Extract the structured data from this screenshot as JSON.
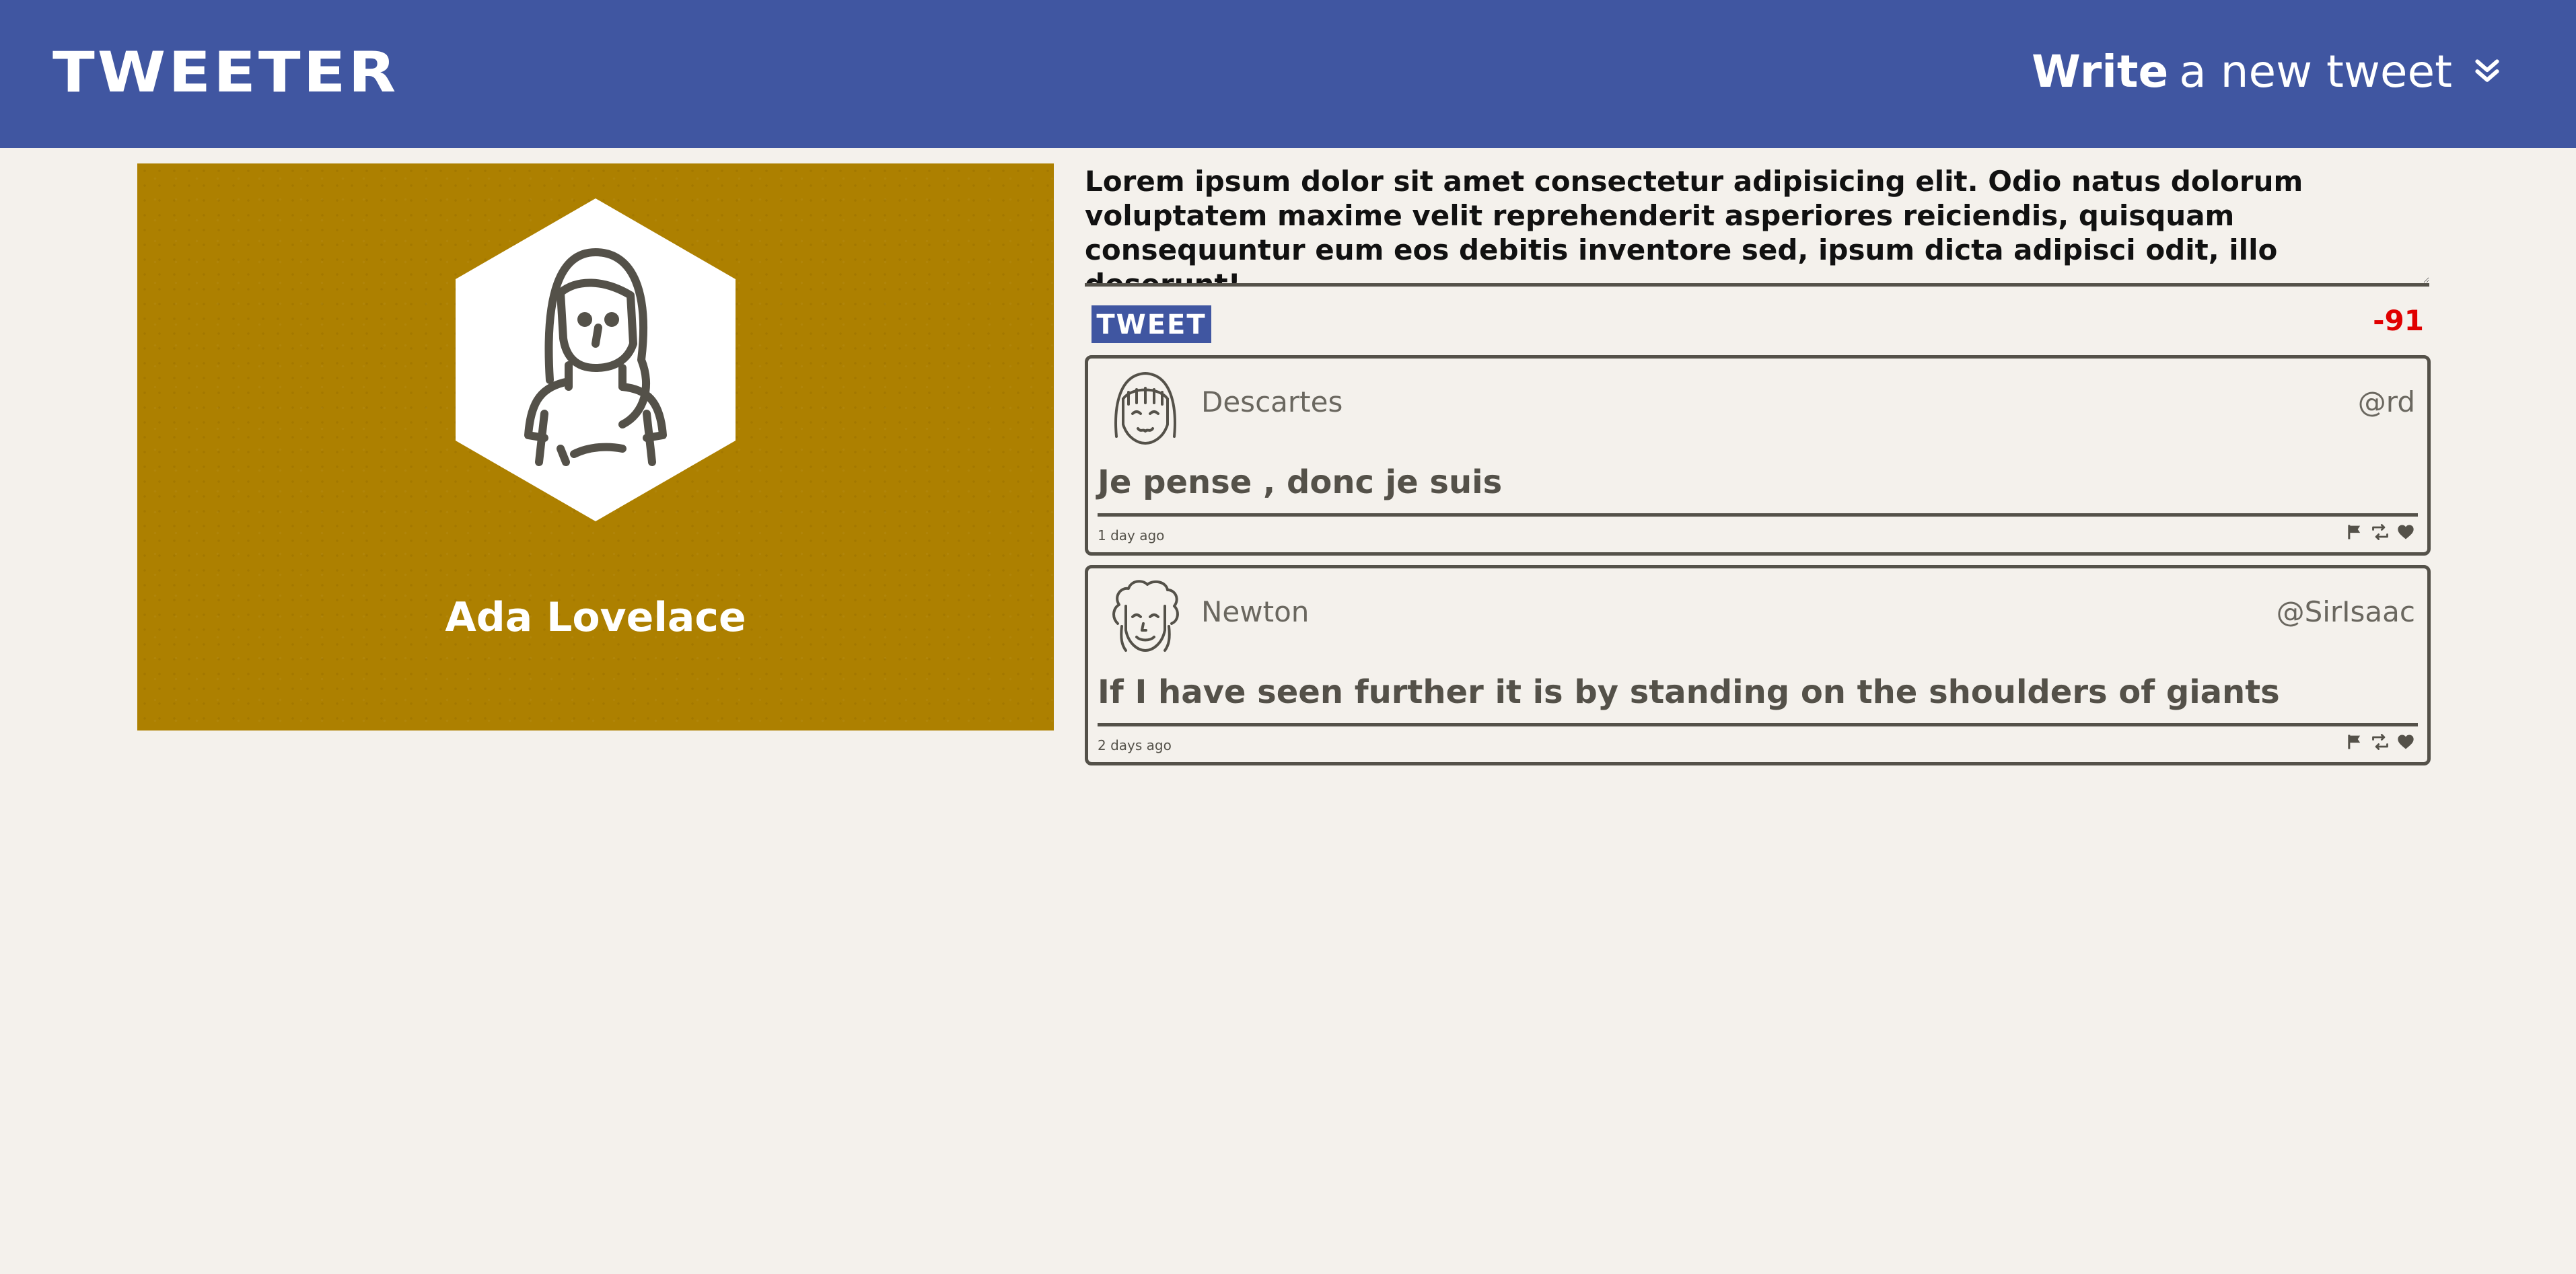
{
  "app": {
    "logo": "TWEETER"
  },
  "header": {
    "write_strong": "Write",
    "write_rest": "a new tweet",
    "icon": "double-chevron-down-icon"
  },
  "profile": {
    "name": "Ada Lovelace",
    "avatar_icon": "woman-avatar-icon",
    "background_color": "#ad8000"
  },
  "composer": {
    "text": "Lorem ipsum dolor sit amet consectetur adipisicing elit. Odio natus dolorum voluptatem maxime velit reprehenderit asperiores reiciendis, quisquam consequuntur eum eos debitis inventore sed, ipsum dicta adipisci odit, illo deserunt!",
    "submit_label": "TWEET",
    "counter": "-91"
  },
  "tweets": [
    {
      "name": "Descartes",
      "handle": "@rd",
      "content": "Je pense , donc je suis",
      "time": "1 day ago",
      "avatar_icon": "descartes-avatar-icon"
    },
    {
      "name": "Newton",
      "handle": "@SirIsaac",
      "content": "If I have seen further it is by standing on the shoulders of giants",
      "time": "2 days ago",
      "avatar_icon": "newton-avatar-icon"
    }
  ],
  "colors": {
    "header": "#4056a1",
    "background": "#f4f1ec",
    "text": "#545149",
    "counter": "#e00000"
  }
}
